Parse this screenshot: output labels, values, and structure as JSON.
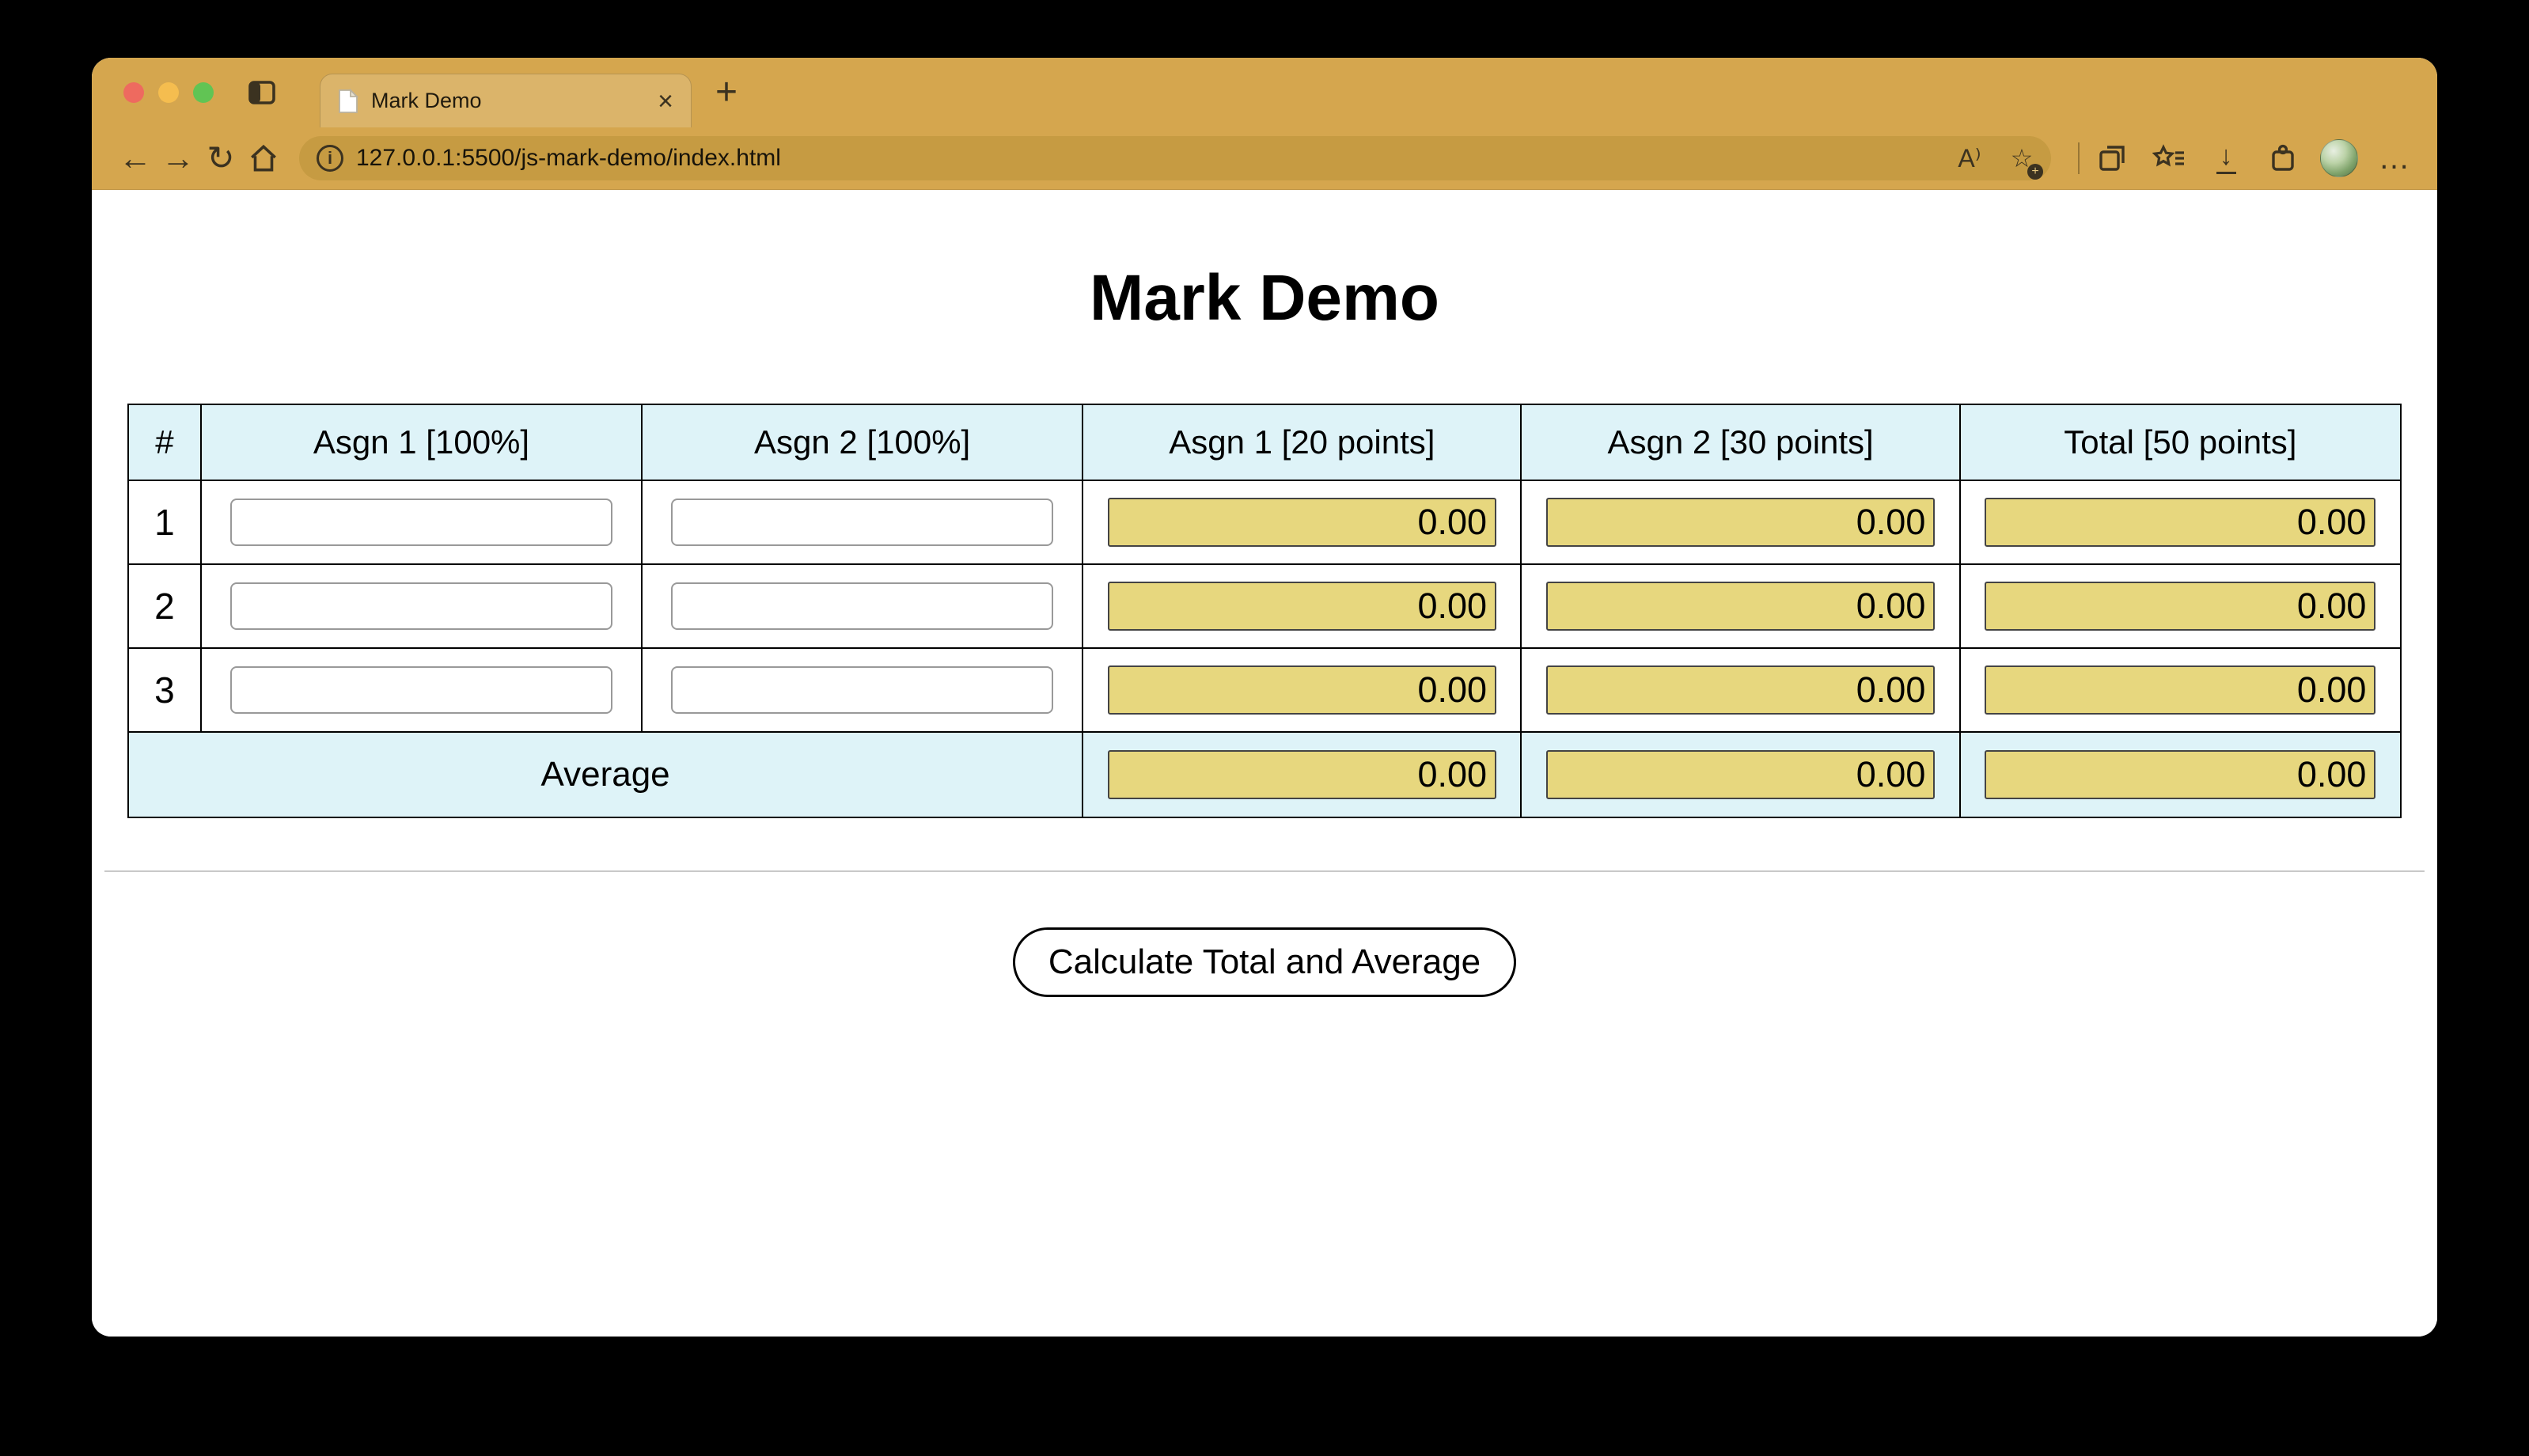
{
  "browser": {
    "tab": {
      "title": "Mark Demo"
    },
    "url": "127.0.0.1:5500/js-mark-demo/index.html"
  },
  "icons": {
    "back": "←",
    "forward": "→",
    "reload": "↻",
    "info_letter": "i",
    "close_tab": "×",
    "new_tab": "+",
    "read_aloud": "A⁾",
    "favorite_star": "☆",
    "favorite_badge": "+",
    "download": "↓",
    "more": "…"
  },
  "page": {
    "title": "Mark Demo",
    "table": {
      "headers": [
        "#",
        "Asgn 1 [100%]",
        "Asgn 2 [100%]",
        "Asgn 1 [20 points]",
        "Asgn 2 [30 points]",
        "Total [50 points]"
      ],
      "rows": [
        {
          "num": "1",
          "asgn1": "",
          "asgn2": "",
          "asgn1_points": "0.00",
          "asgn2_points": "0.00",
          "total": "0.00"
        },
        {
          "num": "2",
          "asgn1": "",
          "asgn2": "",
          "asgn1_points": "0.00",
          "asgn2_points": "0.00",
          "total": "0.00"
        },
        {
          "num": "3",
          "asgn1": "",
          "asgn2": "",
          "asgn1_points": "0.00",
          "asgn2_points": "0.00",
          "total": "0.00"
        }
      ],
      "average_label": "Average",
      "average": {
        "asgn1_points": "0.00",
        "asgn2_points": "0.00",
        "total": "0.00"
      }
    },
    "button_label": "Calculate Total and Average"
  },
  "colors": {
    "chrome": "#d5a64e",
    "urlbar": "#c69b42",
    "traffic_red": "#ee6a5f",
    "traffic_yellow": "#f5bd4f",
    "traffic_green": "#61c454",
    "table_header_bg": "#def3f8",
    "output_field_bg": "#e7d77e"
  }
}
